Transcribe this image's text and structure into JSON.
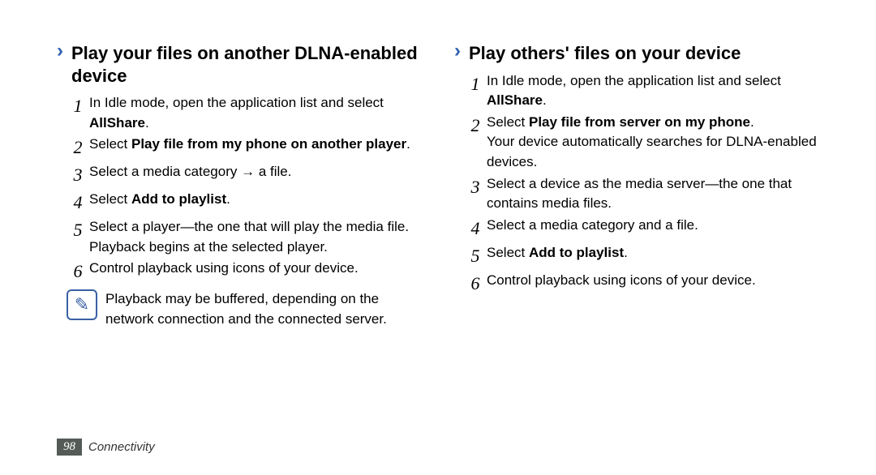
{
  "left": {
    "title": "Play your files on another DLNA-enabled device",
    "steps": [
      {
        "n": "1",
        "pre": "In Idle mode, open the application list and select ",
        "bold": "AllShare",
        "post": "."
      },
      {
        "n": "2",
        "pre": "Select ",
        "bold": "Play file from my phone on another player",
        "post": "."
      },
      {
        "n": "3",
        "pre": "Select a media category → a file.",
        "bold": "",
        "post": ""
      },
      {
        "n": "4",
        "pre": "Select ",
        "bold": "Add to playlist",
        "post": "."
      },
      {
        "n": "5",
        "pre": "Select a player—the one that will play the media file. Playback begins at the selected player.",
        "bold": "",
        "post": ""
      },
      {
        "n": "6",
        "pre": "Control playback using icons of your device.",
        "bold": "",
        "post": ""
      }
    ],
    "note": "Playback may be buffered, depending on the network connection and the connected server."
  },
  "right": {
    "title": "Play others' files on your device",
    "steps": [
      {
        "n": "1",
        "pre": "In Idle mode, open the application list and select ",
        "bold": "AllShare",
        "post": "."
      },
      {
        "n": "2",
        "pre": "Select ",
        "bold": "Play file from server on my phone",
        "post": ".",
        "extra": "Your device automatically searches for DLNA-enabled devices."
      },
      {
        "n": "3",
        "pre": "Select a device as the media server—the one that contains media files.",
        "bold": "",
        "post": ""
      },
      {
        "n": "4",
        "pre": "Select a media category and a file.",
        "bold": "",
        "post": ""
      },
      {
        "n": "5",
        "pre": "Select ",
        "bold": "Add to playlist",
        "post": "."
      },
      {
        "n": "6",
        "pre": "Control playback using icons of your device.",
        "bold": "",
        "post": ""
      }
    ]
  },
  "footer": {
    "page": "98",
    "section": "Connectivity"
  },
  "icons": {
    "note": "✎"
  }
}
